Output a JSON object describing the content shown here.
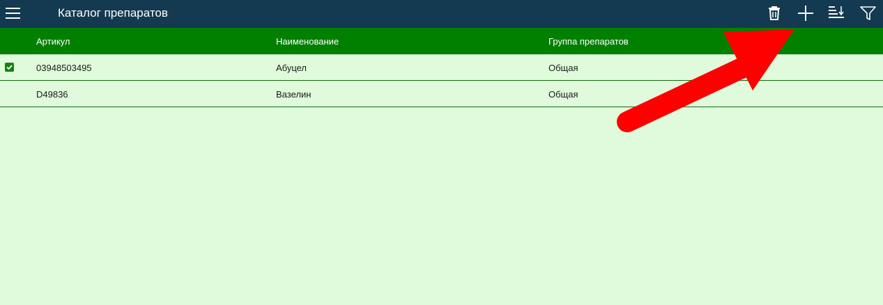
{
  "app": {
    "title": "Каталог препаратов"
  },
  "toolbar": {
    "icons": [
      "menu-icon",
      "trash-icon",
      "plus-icon",
      "sort-icon",
      "filter-icon"
    ]
  },
  "table": {
    "columns": [
      "Артикул",
      "Наименование",
      "Группа препаратов"
    ],
    "rows": [
      {
        "selected": true,
        "article": "03948503495",
        "name": "Абуцел",
        "group": "Общая"
      },
      {
        "selected": false,
        "article": "D49836",
        "name": "Вазелин",
        "group": "Общая"
      }
    ]
  },
  "colors": {
    "topbar": "#143a52",
    "header": "#018000",
    "background": "#e0fbdc",
    "annotation_arrow": "#ff0000"
  }
}
